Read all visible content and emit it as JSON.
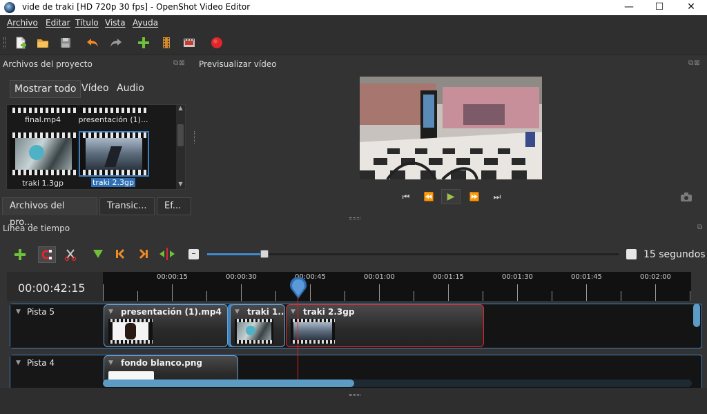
{
  "window": {
    "title": "vide de traki [HD 720p 30 fps] - OpenShot Video Editor",
    "minimize": "—",
    "maximize": "☐",
    "close": "✕"
  },
  "menu": [
    "Archivo",
    "Editar",
    "Título",
    "Vista",
    "Ayuda"
  ],
  "toolbar": {
    "icons": [
      "new-project-icon",
      "open-project-icon",
      "save-project-icon",
      "undo-icon",
      "redo-icon",
      "import-files-icon",
      "choose-profile-icon",
      "fullscreen-icon",
      "export-video-icon"
    ],
    "accent_green": "#6fbf3a",
    "accent_red": "#e0262b",
    "accent_orange": "#f08a24"
  },
  "project_files": {
    "title": "Archivos del proyecto",
    "filters": [
      "Mostrar todo",
      "Vídeo",
      "Audio"
    ],
    "files": [
      {
        "name": "final.mp4"
      },
      {
        "name": "presentación (1)..."
      },
      {
        "name": "traki 1.3gp"
      },
      {
        "name": "traki 2.3gp",
        "selected": true
      }
    ],
    "tabs": [
      "Archivos del pro...",
      "Transic...",
      "Ef..."
    ]
  },
  "preview": {
    "title": "Previsualizar vídeo",
    "controls": [
      "jump-start-icon",
      "rewind-icon",
      "play-icon",
      "fast-forward-icon",
      "jump-end-icon"
    ],
    "camera": "camera-icon"
  },
  "timeline": {
    "title": "Línea de tiempo",
    "tools": [
      "add-track-icon",
      "snapping-icon",
      "razor-icon",
      "add-marker-icon",
      "previous-marker-icon",
      "next-marker-icon",
      "center-playhead-icon",
      "zoom-out-icon"
    ],
    "zoom_label": "15 segundos",
    "zoom_level": 0.14,
    "current_time": "00:00:42:15",
    "ruler_labels": [
      "00:00:15",
      "00:00:30",
      "00:00:45",
      "00:01:00",
      "00:01:15",
      "00:01:30",
      "00:01:45",
      "00:02:00"
    ],
    "tracks": [
      {
        "name": "Pista 5",
        "clips": [
          {
            "title": "presentación (1).mp4"
          },
          {
            "title": "traki 1...."
          },
          {
            "title": "traki 2.3gp",
            "selected": true
          }
        ]
      },
      {
        "name": "Pista 4",
        "clips": [
          {
            "title": "fondo blanco.png"
          }
        ]
      }
    ]
  }
}
